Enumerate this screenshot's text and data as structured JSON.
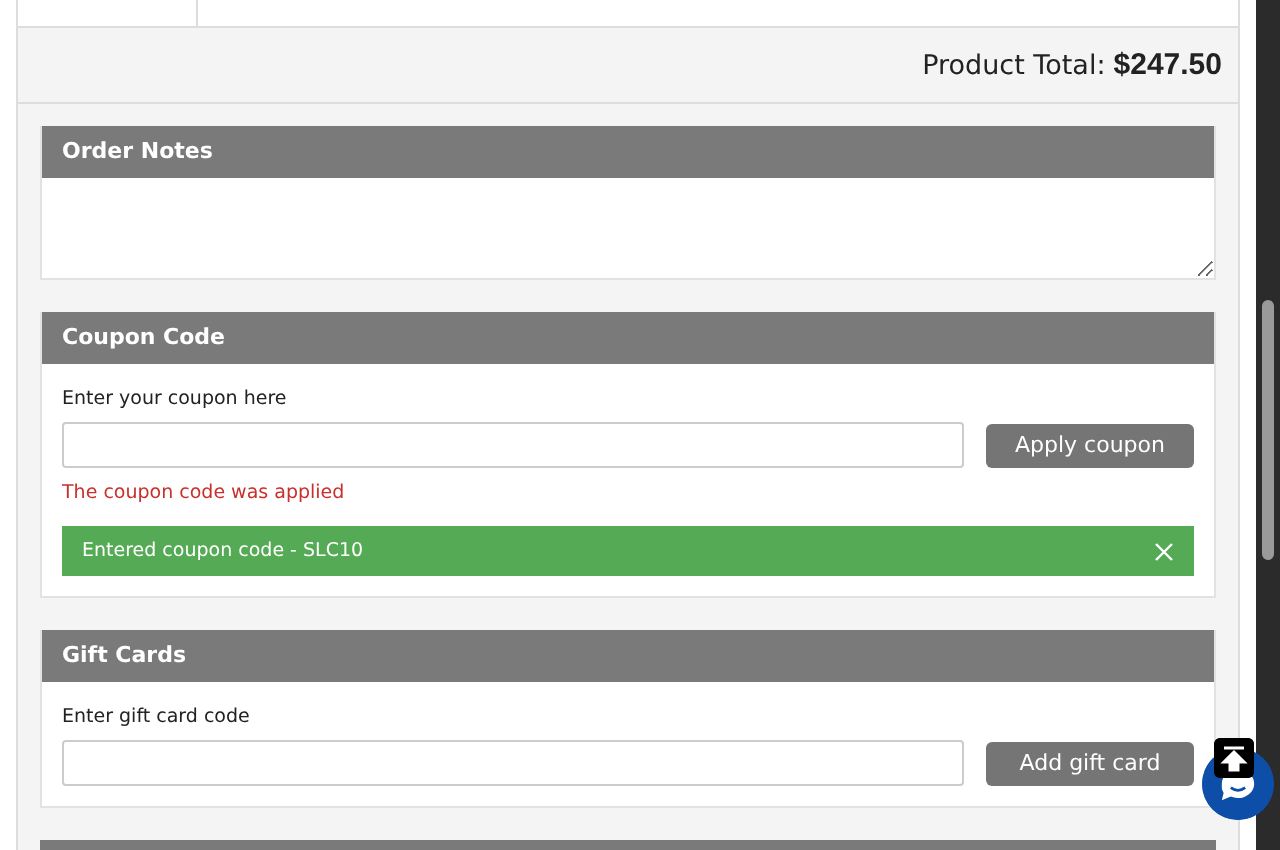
{
  "product_total": {
    "label": "Product Total:",
    "amount": "$247.50"
  },
  "order_notes": {
    "title": "Order Notes"
  },
  "coupon": {
    "title": "Coupon Code",
    "label": "Enter your coupon here",
    "button": "Apply coupon",
    "message": "The coupon code was applied",
    "notice": "Entered coupon code - SLC10"
  },
  "gift_cards": {
    "title": "Gift Cards",
    "label": "Enter gift card code",
    "button": "Add gift card"
  }
}
